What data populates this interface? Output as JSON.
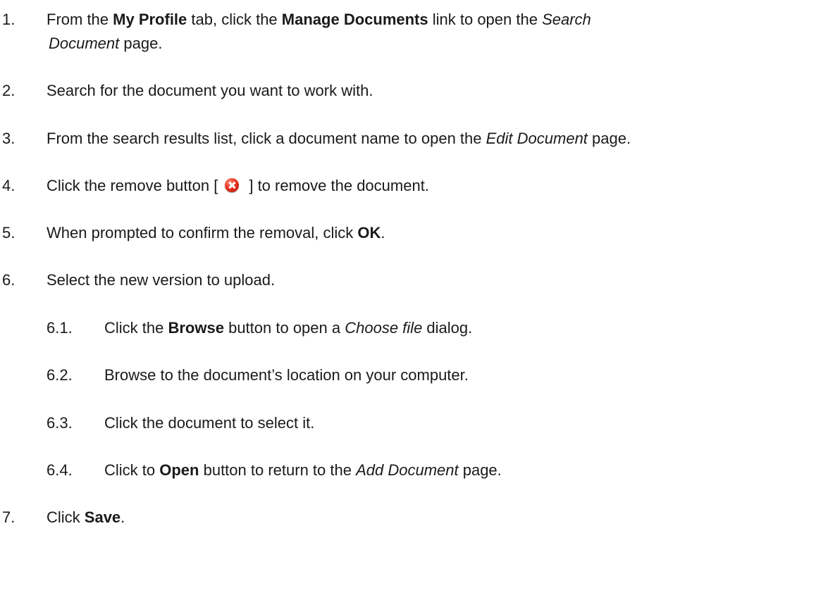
{
  "steps": [
    {
      "num": "1.",
      "parts": [
        "From the ",
        "My Profile",
        " tab, click the ",
        "Manage Documents",
        " link to open the ",
        "Search"
      ],
      "continuation": [
        "Document",
        " page."
      ]
    },
    {
      "num": "2.",
      "parts": [
        "Search for the document you want to work with."
      ]
    },
    {
      "num": "3.",
      "parts": [
        "From the search results list, click a document name to open the ",
        "Edit Document",
        " page."
      ]
    },
    {
      "num": "4.",
      "parts": [
        "Click the remove button [",
        "] to remove the document."
      ],
      "icon": "remove-icon"
    },
    {
      "num": "5.",
      "parts": [
        "When prompted to confirm the removal, click ",
        "OK",
        "."
      ]
    },
    {
      "num": "6.",
      "parts": [
        "Select the new version to upload."
      ]
    },
    {
      "num": "7.",
      "parts": [
        "Click ",
        "Save",
        "."
      ]
    }
  ],
  "substeps": [
    {
      "num": "6.1.",
      "parts": [
        "Click the ",
        "Browse",
        " button to open a ",
        "Choose file",
        " dialog."
      ]
    },
    {
      "num": "6.2.",
      "parts": [
        "Browse to the document’s location on your computer."
      ]
    },
    {
      "num": "6.3.",
      "parts": [
        "Click the document to select it."
      ]
    },
    {
      "num": "6.4.",
      "parts": [
        "Click to ",
        "Open",
        " button to return to the ",
        "Add Document",
        " page."
      ]
    }
  ]
}
